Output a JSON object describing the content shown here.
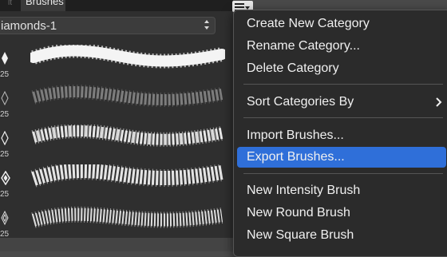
{
  "panel": {
    "tab_prev_label": "lt",
    "tab_active_label": "Brushes",
    "category_selected": "iamonds-1"
  },
  "brushes": [
    {
      "size": "25",
      "style": "solid"
    },
    {
      "size": "25",
      "style": "faded"
    },
    {
      "size": "25",
      "style": "mesh"
    },
    {
      "size": "25",
      "style": "mesh-wide"
    },
    {
      "size": "25",
      "style": "mesh-dense"
    }
  ],
  "menu": {
    "items": [
      {
        "label": "Create New Category"
      },
      {
        "label": "Rename Category..."
      },
      {
        "label": "Delete Category"
      },
      {
        "label": "Sort Categories By"
      },
      {
        "label": "Import Brushes..."
      },
      {
        "label": "Export Brushes...",
        "selected": true
      },
      {
        "label": "New Intensity Brush"
      },
      {
        "label": "New Round Brush"
      },
      {
        "label": "New Square Brush"
      }
    ]
  },
  "colors": {
    "selection": "#2f6fd9",
    "menu_bg": "#2b2b2b",
    "panel_bg": "#2f2f2f"
  }
}
